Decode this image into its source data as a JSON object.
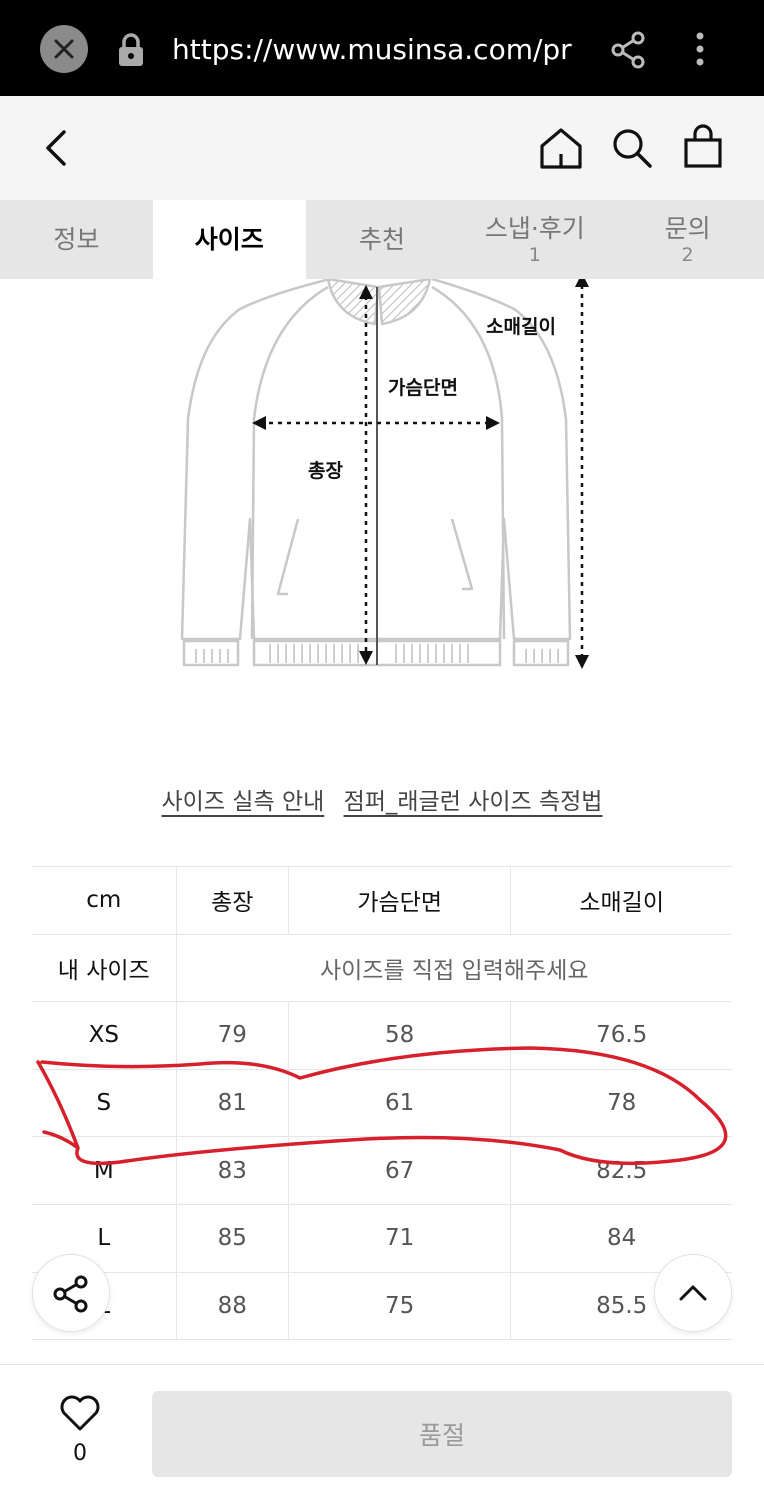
{
  "browser": {
    "url": "https://www.musinsa.com/pr"
  },
  "tabs": [
    {
      "label": "정보",
      "count": ""
    },
    {
      "label": "사이즈",
      "count": ""
    },
    {
      "label": "추천",
      "count": ""
    },
    {
      "label": "스냅·후기",
      "count": "1"
    },
    {
      "label": "문의",
      "count": "2"
    }
  ],
  "diagram": {
    "sleeve_label": "소매길이",
    "chest_label": "가슴단면",
    "length_label": "총장"
  },
  "links": {
    "size_guide": "사이즈 실측 안내",
    "measure_method": "점퍼_래글런 사이즈 측정법"
  },
  "table": {
    "headers": [
      "cm",
      "총장",
      "가슴단면",
      "소매길이"
    ],
    "my_size_label": "내 사이즈",
    "my_size_placeholder": "사이즈를 직접 입력해주세요",
    "rows": [
      {
        "size": "XS",
        "v1": "79",
        "v2": "58",
        "v3": "76.5"
      },
      {
        "size": "S",
        "v1": "81",
        "v2": "61",
        "v3": "78"
      },
      {
        "size": "M",
        "v1": "83",
        "v2": "67",
        "v3": "82.5"
      },
      {
        "size": "L",
        "v1": "85",
        "v2": "71",
        "v3": "84"
      },
      {
        "size": "L",
        "v1": "88",
        "v2": "75",
        "v3": "85.5"
      }
    ]
  },
  "bottom": {
    "like_count": "0",
    "soldout_label": "품절"
  },
  "colors": {
    "annotation_red": "#d6202b"
  }
}
